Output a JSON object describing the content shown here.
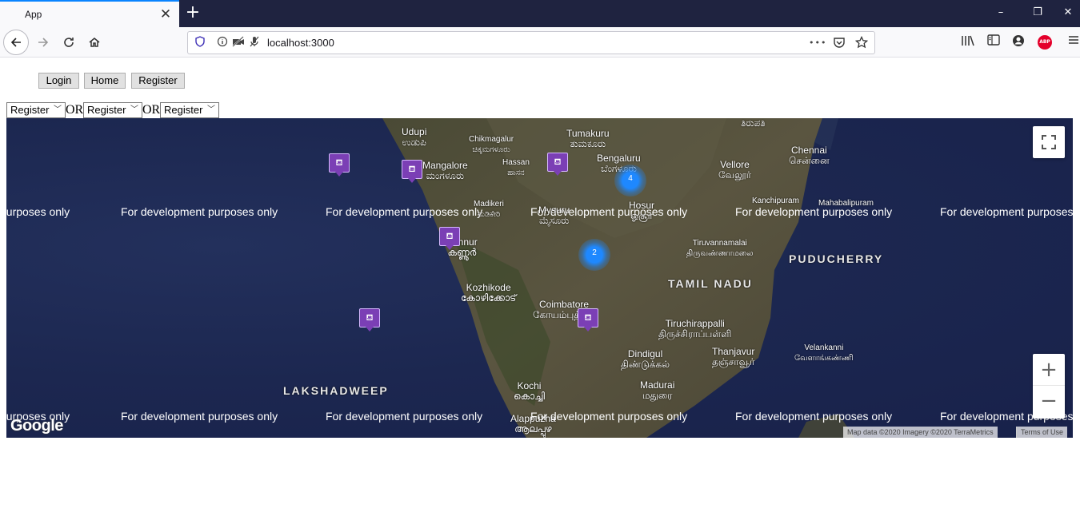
{
  "browser": {
    "tab_title": "App",
    "tab_close": "✕",
    "new_tab": "+",
    "url": "localhost:3000",
    "window_buttons": [
      "–",
      "❐",
      "✕"
    ],
    "more": "•••",
    "abp": "ABP"
  },
  "page": {
    "buttons": [
      "Login",
      "Home",
      "Register"
    ],
    "selects": [
      "Register",
      "Register",
      "Register"
    ],
    "separator": "OR"
  },
  "map": {
    "watermark": "For development purposes only",
    "watermark_left_clipped": "purposes only",
    "watermark_right_clipped": "For development purposes",
    "places": {
      "udupi": "Udupi\nಉಡುಪಿ",
      "chikmagalur": "Chikmagalur\nಚಿಕ್ಕಮಗಳೂರು",
      "tumakuru": "Tumakuru\nತುಮಕೂರು",
      "tirupati": "ತಿರುಪತಿ",
      "chennai": "Chennai\nசென்னை",
      "mangalore": "Mangalore\nಮಂಗಳೂರು",
      "hassan": "Hassan\nಹಾಸನ",
      "bengaluru": "Bengaluru\nಬೆಂಗಳೂರು",
      "vellore": "Vellore\nவேலூர்",
      "kanchipuram": "Kanchipuram",
      "mahabalipuram": "Mahabalipuram",
      "madikeri": "Madikeri\nಮಡಿಕೇರಿ",
      "mysuru": "Mysuru\nಮೈಸೂರು",
      "hosur": "Hosur\nஓசூர்",
      "kannur": "Kannur\nകണ്ണൂർ",
      "tiruvannamalai": "Tiruvannamalai\nதிருவண்ணாமலை",
      "puducherry": "PUDUCHERRY",
      "kozhikode": "Kozhikode\nകോഴിക്കോട്",
      "tamil_nadu": "TAMIL NADU",
      "coimbatore": "Coimbatore\nகோயம்புத்தூர்",
      "tiruchirappalli": "Tiruchirappalli\nதிருச்சிராப்பள்ளி",
      "velankanni": "Velankanni\nவேளாங்கண்ணி",
      "thanjavur": "Thanjavur\nதஞ்சாவூர்",
      "dindigul": "Dindigul\nதிண்டுக்கல்",
      "kochi": "Kochi\nകൊച്ചി",
      "madurai": "Madurai\nமதுரை",
      "lakshadweep": "LAKSHADWEEP",
      "alappuzha": "Alappuzha\nആലപ്പുഴ"
    },
    "clusters": [
      "4",
      "2"
    ],
    "marker_glyph": "⛾",
    "google": "Google",
    "attribution": "Map data ©2020 Imagery ©2020 TerraMetrics",
    "terms": "Terms of Use",
    "zoom_in": "+",
    "zoom_out": "−",
    "fullscreen": "⛶"
  }
}
